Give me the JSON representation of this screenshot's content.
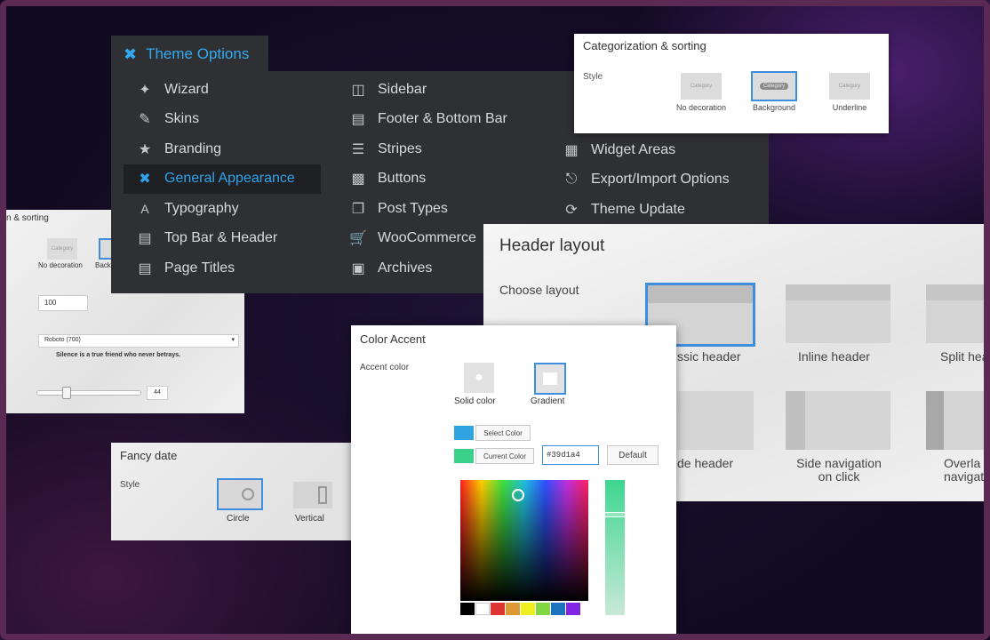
{
  "theme_options": {
    "title": "Theme Options",
    "col1": [
      {
        "label": "Wizard",
        "icon": "wand-icon"
      },
      {
        "label": "Skins",
        "icon": "brush-icon"
      },
      {
        "label": "Branding",
        "icon": "star-icon"
      },
      {
        "label": "General Appearance",
        "icon": "tools-icon",
        "active": true
      },
      {
        "label": "Typography",
        "icon": "typography-icon"
      },
      {
        "label": "Top Bar & Header",
        "icon": "browser-icon"
      },
      {
        "label": "Page Titles",
        "icon": "page-title-icon"
      }
    ],
    "col2": [
      {
        "label": "Sidebar",
        "icon": "sidebar-icon"
      },
      {
        "label": "Footer & Bottom Bar",
        "icon": "footer-icon"
      },
      {
        "label": "Stripes",
        "icon": "stripes-icon"
      },
      {
        "label": "Buttons",
        "icon": "buttons-icon"
      },
      {
        "label": "Post Types",
        "icon": "post-types-icon"
      },
      {
        "label": "WooCommerce",
        "icon": "cart-icon"
      },
      {
        "label": "Archives",
        "icon": "archive-icon"
      }
    ],
    "col3": [
      {
        "label": "Widget Areas",
        "icon": "grid-icon"
      },
      {
        "label": "Export/Import Options",
        "icon": "export-icon"
      },
      {
        "label": "Theme Update",
        "icon": "update-icon"
      }
    ]
  },
  "categorization": {
    "title": "Categorization & sorting",
    "style_label": "Style",
    "options": [
      {
        "thumb": "Category",
        "caption": "No decoration"
      },
      {
        "thumb": "Category",
        "caption": "Background",
        "selected": true
      },
      {
        "thumb": "Category",
        "caption": "Underline"
      }
    ]
  },
  "left_panel": {
    "title_fragment": "n & sorting",
    "option_thumb": "Category",
    "option_caption": "No decoration",
    "option2_caption": "Back",
    "number_value": "100",
    "font_select": "Roboto (700)",
    "sample_text": "Silence is a true friend who never betrays.",
    "slider_value": "44",
    "slider_level": 0.28
  },
  "fancy_date": {
    "title": "Fancy date",
    "style_label": "Style",
    "options": [
      {
        "caption": "Circle",
        "selected": true
      },
      {
        "caption": "Vertical"
      }
    ]
  },
  "header_layout": {
    "title": "Header layout",
    "choose_label": "Choose layout",
    "layouts": [
      {
        "caption": "Classic header",
        "visible_caption": "ssic header",
        "selected": true
      },
      {
        "caption": "Inline header"
      },
      {
        "caption": "Split header",
        "visible_caption": "Split hea"
      },
      {
        "caption": "Side header",
        "visible_caption": "de header"
      },
      {
        "caption": "Side navigation on click",
        "line1": "Side navigation",
        "line2": "on click"
      },
      {
        "caption": "Overlay navigation",
        "line1": "Overla",
        "line2": "navigat"
      }
    ]
  },
  "color_accent": {
    "title": "Color Accent",
    "accent_label": "Accent color",
    "modes": [
      {
        "caption": "Solid color"
      },
      {
        "caption": "Gradient",
        "selected": true
      }
    ],
    "select_color_label": "Select Color",
    "current_color_label": "Current Color",
    "hex_value": "#39d1a4",
    "default_label": "Default",
    "colors": {
      "select": "#2fa4e0",
      "current": "#39d18a",
      "hue_slider": "#3ed690"
    },
    "palette": [
      "#000000",
      "#ffffff",
      "#dd3333",
      "#dd9933",
      "#eeee22",
      "#81d742",
      "#1e73be",
      "#8224e3"
    ]
  }
}
